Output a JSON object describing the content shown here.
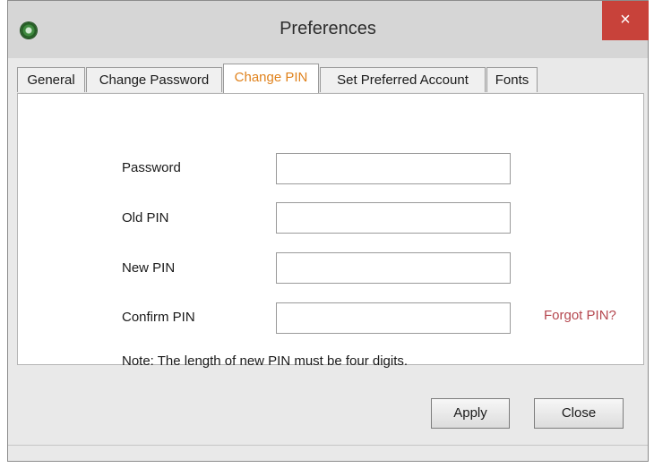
{
  "window": {
    "title": "Preferences",
    "close_label": "×"
  },
  "tabs": [
    {
      "label": "General",
      "active": false
    },
    {
      "label": "Change Password",
      "active": false
    },
    {
      "label": "Change PIN",
      "active": true
    },
    {
      "label": "Set Preferred Account",
      "active": false
    },
    {
      "label": "Fonts",
      "active": false
    }
  ],
  "form": {
    "fields": [
      {
        "label": "Password",
        "value": ""
      },
      {
        "label": "Old PIN",
        "value": ""
      },
      {
        "label": "New PIN",
        "value": ""
      },
      {
        "label": "Confirm PIN",
        "value": ""
      }
    ],
    "forgot_link": "Forgot PIN?",
    "note": "Note: The length of new PIN must be four digits."
  },
  "buttons": {
    "apply": "Apply",
    "close": "Close"
  },
  "colors": {
    "active_tab": "#e0821c",
    "link": "#b5474f",
    "close_button": "#c8423a"
  }
}
